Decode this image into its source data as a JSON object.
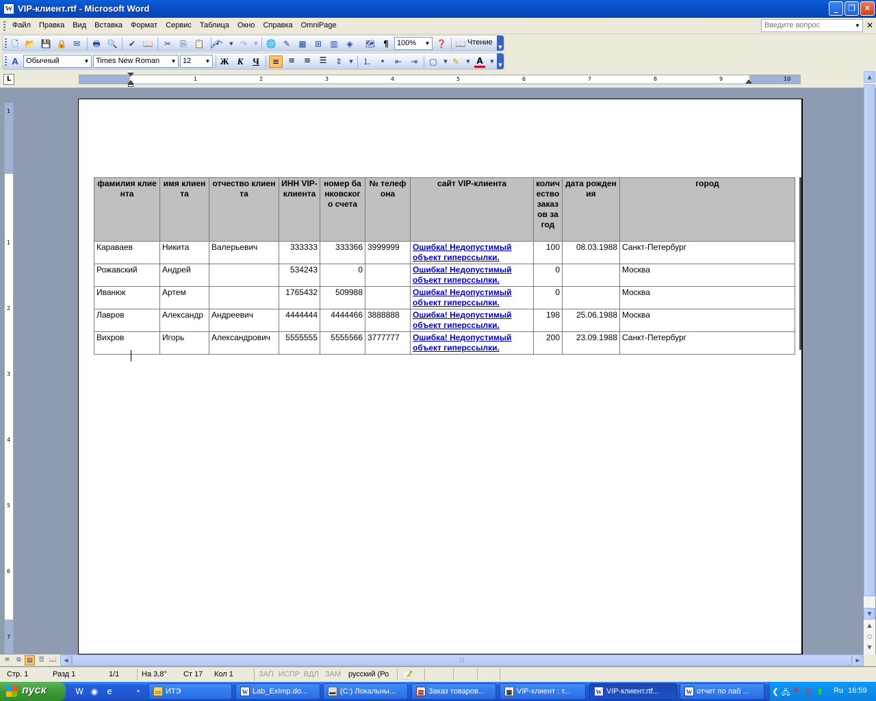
{
  "window": {
    "title": "VIP-клиент.rtf - Microsoft Word"
  },
  "menu": {
    "items": [
      "Файл",
      "Правка",
      "Вид",
      "Вставка",
      "Формат",
      "Сервис",
      "Таблица",
      "Окно",
      "Справка",
      "OmniPage"
    ],
    "ask_placeholder": "Введите вопрос"
  },
  "toolbar": {
    "zoom": "100%",
    "reading_label": "Чтение",
    "style": "Обычный",
    "font": "Times New Roman",
    "font_size": "12",
    "bold_label": "Ж",
    "italic_label": "К",
    "underline_label": "Ч"
  },
  "ruler": {
    "h_numbers": [
      "1",
      "1",
      "2",
      "3",
      "4",
      "5",
      "6",
      "7",
      "8",
      "9",
      "10"
    ],
    "v_numbers": [
      "1",
      "1",
      "2",
      "3",
      "4",
      "5",
      "6",
      "7"
    ]
  },
  "table": {
    "headers": [
      "фамилия клиента",
      "имя клиента",
      "отчество клиента",
      "ИНН VIP-клиента",
      "номер банковского счета",
      "№ телефона",
      "сайт VIP-клиента",
      "количество заказов за год",
      "дата рождения",
      "город"
    ],
    "rows": [
      [
        "Караваев",
        "Никита",
        "Валерьевич",
        "333333",
        "333366",
        "3999999",
        "Ошибка! Недопустимый объект гиперссылки.",
        "100",
        "08.03.1988",
        "Санкт-Петербург"
      ],
      [
        "Рожавский",
        "Андрей",
        "",
        "534243",
        "0",
        "",
        "Ошибка! Недопустимый объект гиперссылки.",
        "0",
        "",
        "Москва"
      ],
      [
        "Иванюк",
        "Артем",
        "",
        "1765432",
        "509988",
        "",
        "Ошибка! Недопустимый объект гиперссылки.",
        "0",
        "",
        "Москва"
      ],
      [
        "Лавров",
        "Александр",
        "Андреевич",
        "4444444",
        "4444466",
        "3888888",
        "Ошибка! Недопустимый объект гиперссылки.",
        "198",
        "25.06.1988",
        "Москва"
      ],
      [
        "Вихров",
        "Игорь",
        "Александрович",
        "5555555",
        "5555566",
        "3777777",
        "Ошибка! Недопустимый объект гиперссылки.",
        "200",
        "23.09.1988",
        "Санкт-Петербург"
      ]
    ]
  },
  "status": {
    "page": "Стр. 1",
    "section": "Разд 1",
    "pages": "1/1",
    "at": "На 3,8\"",
    "line": "Ст 17",
    "col": "Кол 1",
    "rec": "ЗАП",
    "trk": "ИСПР",
    "ext": "ВДЛ",
    "ovr": "ЗАМ",
    "lang": "русский (Ро"
  },
  "taskbar": {
    "start_label": "пуск",
    "tasks": [
      "ИТЭ",
      "Lab_ExImp.do...",
      "(C:) Локальны...",
      "Заказ товаров...",
      "VIP-клиент : т...",
      "VIP-клиент.rtf...",
      "отчет по лаб ..."
    ],
    "tray_lang": "Ru",
    "clock": "16:59"
  }
}
